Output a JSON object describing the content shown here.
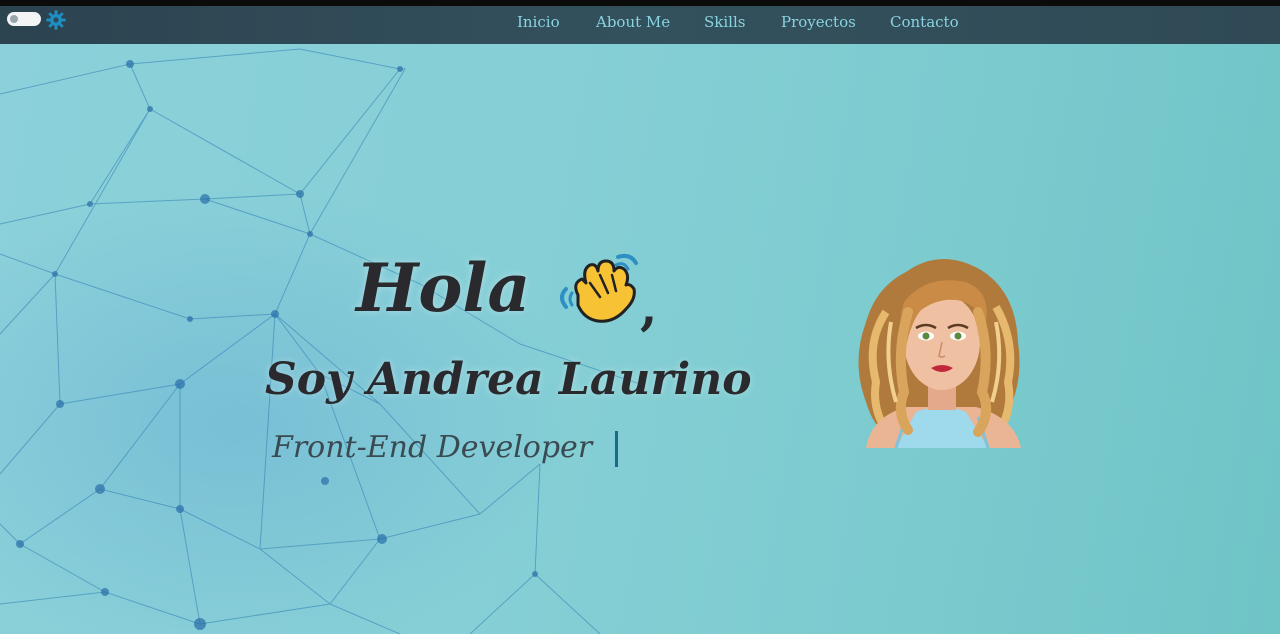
{
  "nav": {
    "items": [
      "Inicio",
      "About Me",
      "Skills",
      "Proyectos",
      "Contacto"
    ]
  },
  "hero": {
    "greeting": "Hola",
    "greeting_punct": ",",
    "name": "Soy Andrea Laurino",
    "role": "Front-End Developer"
  },
  "icons": {
    "theme_toggle": "toggle-switch",
    "settings": "gear-icon",
    "wave": "waving-hand-icon",
    "avatar": "avatar-illustration"
  },
  "colors": {
    "navbar": "#2f4a55",
    "nav_link": "#8ad3e0",
    "hero_bg": "#86cfd6",
    "text": "#2a2a2e"
  }
}
